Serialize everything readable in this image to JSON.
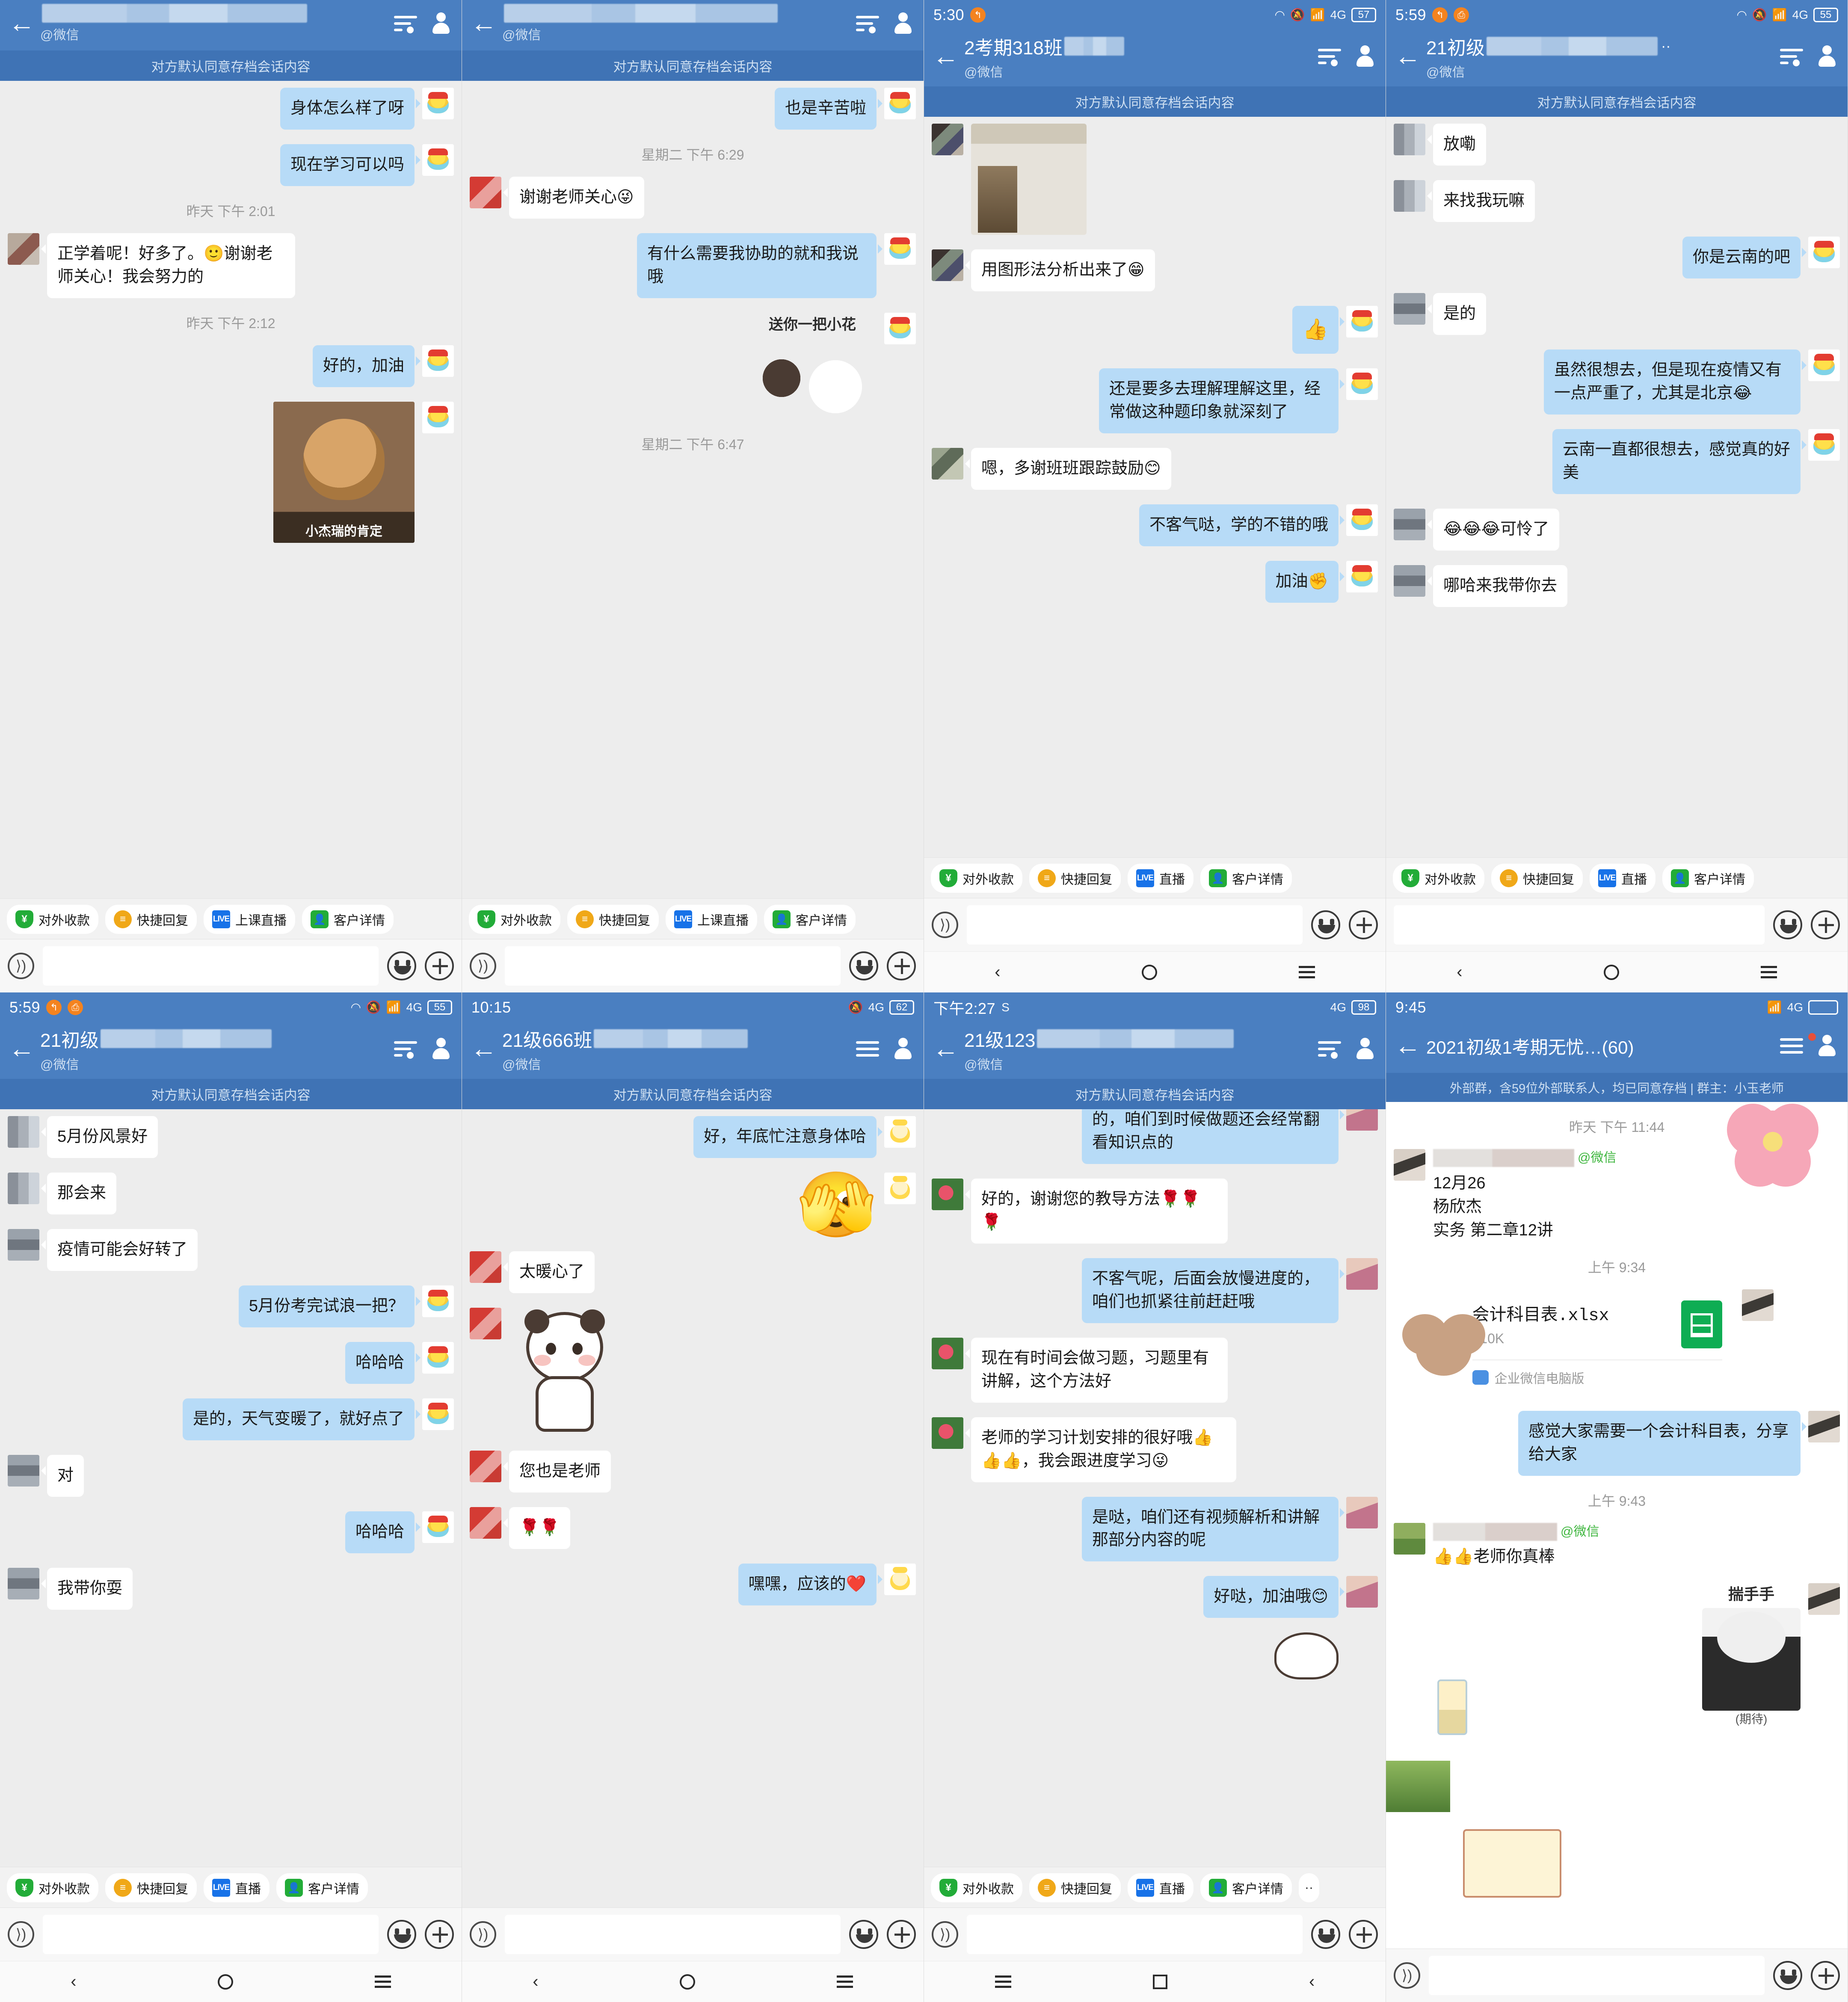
{
  "common": {
    "archive_notice": "对方默认同意存档会话内容",
    "subtitle": "@微信",
    "quick_actions": [
      {
        "label": "对外收款",
        "icon": "pay-icon"
      },
      {
        "label": "快捷回复",
        "icon": "quick-reply-icon"
      },
      {
        "label": "上课直播",
        "icon": "live-icon"
      },
      {
        "label": "客户详情",
        "icon": "customer-icon"
      }
    ],
    "quick_actions_short": [
      {
        "label": "对外收款",
        "icon": "pay-icon"
      },
      {
        "label": "快捷回复",
        "icon": "quick-reply-icon"
      },
      {
        "label": "直播",
        "icon": "live-icon"
      },
      {
        "label": "客户详情",
        "icon": "customer-icon"
      }
    ],
    "live_badge": "LIVE",
    "colors": {
      "header_blue": "#4a7fc1",
      "archive_blue": "#3f73b5",
      "bubble_out": "#b7dbf7",
      "bubble_in": "#ffffff",
      "chat_bg": "#ededed",
      "accent_green": "#22ac38",
      "accent_orange": "#f0a818",
      "accent_live": "#1772e8",
      "badge_red": "#e8503a",
      "status_orange": "#f4831f"
    }
  },
  "panels": [
    {
      "id": "panel-1",
      "status": {
        "time": "",
        "battery": "",
        "net": ""
      },
      "title": "",
      "messages": [
        {
          "side": "out",
          "type": "text",
          "text": "身体怎么样了呀",
          "avatar": "bee"
        },
        {
          "side": "out",
          "type": "text",
          "text": "现在学习可以吗",
          "avatar": "bee"
        },
        {
          "type": "timestamp",
          "text": "昨天 下午 2:01"
        },
        {
          "side": "in",
          "type": "text",
          "text": "正学着呢！好多了。🙂谢谢老师关心！我会努力的",
          "avatar": "mosaic-brown"
        },
        {
          "type": "timestamp",
          "text": "昨天 下午 2:12"
        },
        {
          "side": "out",
          "type": "text",
          "text": "好的，加油",
          "avatar": "bee"
        },
        {
          "side": "out",
          "type": "meme",
          "text": "小杰瑞的肯定",
          "avatar": "bee"
        }
      ]
    },
    {
      "id": "panel-2",
      "status": {
        "time": "",
        "battery": "",
        "net": ""
      },
      "title": "",
      "messages": [
        {
          "side": "out",
          "type": "text",
          "text": "也是辛苦啦",
          "avatar": "bee"
        },
        {
          "type": "timestamp",
          "text": "星期二 下午 6:29"
        },
        {
          "side": "in",
          "type": "text",
          "text": "谢谢老师关心😜",
          "avatar": "mosaic-red"
        },
        {
          "side": "out",
          "type": "text",
          "text": "有什么需要我协助的就和我说哦",
          "avatar": "bee"
        },
        {
          "side": "out",
          "type": "sticker",
          "text": "送你一把小花",
          "avatar": "bee"
        },
        {
          "type": "timestamp",
          "text": "星期二 下午 6:47"
        }
      ]
    },
    {
      "id": "panel-3",
      "status": {
        "time": "5:30",
        "battery": "57",
        "net": "4G"
      },
      "title": "2考期318班",
      "messages": [
        {
          "side": "in",
          "type": "image",
          "avatar": "mosaic-dark"
        },
        {
          "side": "in",
          "type": "text",
          "text": "用图形法分析出来了😁",
          "avatar": "mosaic-dark"
        },
        {
          "side": "out",
          "type": "emoji",
          "text": "👍",
          "avatar": "bee"
        },
        {
          "side": "out",
          "type": "text",
          "text": "还是要多去理解理解这里，经常做这种题印象就深刻了",
          "avatar": "bee"
        },
        {
          "side": "in",
          "type": "text",
          "text": "嗯，多谢班班跟踪鼓励😊",
          "avatar": "mosaic-olive"
        },
        {
          "side": "out",
          "type": "text",
          "text": "不客气哒，学的不错的哦",
          "avatar": "bee"
        },
        {
          "side": "out",
          "type": "text",
          "text": "加油✊",
          "avatar": "bee"
        }
      ]
    },
    {
      "id": "panel-4",
      "status": {
        "time": "5:59",
        "battery": "55",
        "net": "4G"
      },
      "title": "21初级",
      "messages": [
        {
          "side": "in",
          "type": "text",
          "text": "放嘞",
          "avatar": "mosaic-gray"
        },
        {
          "side": "in",
          "type": "text",
          "text": "来找我玩嘛",
          "avatar": "mosaic-gray"
        },
        {
          "side": "out",
          "type": "text",
          "text": "你是云南的吧",
          "avatar": "bee"
        },
        {
          "side": "in",
          "type": "text",
          "text": "是的",
          "avatar": "mosaic-gray2"
        },
        {
          "side": "out",
          "type": "text",
          "text": "虽然很想去，但是现在疫情又有一点严重了，尤其是北京😂",
          "avatar": "bee"
        },
        {
          "side": "out",
          "type": "text",
          "text": "云南一直都很想去，感觉真的好美",
          "avatar": "bee"
        },
        {
          "side": "in",
          "type": "text",
          "text": "😂😂😂可怜了",
          "avatar": "mosaic-gray2"
        },
        {
          "side": "in",
          "type": "text",
          "text": "哪哈来我带你去",
          "avatar": "mosaic-gray2"
        }
      ]
    },
    {
      "id": "panel-5",
      "status": {
        "time": "5:59",
        "battery": "55",
        "net": "4G"
      },
      "title": "21初级",
      "messages": [
        {
          "side": "in",
          "type": "text",
          "text": "5月份风景好",
          "avatar": "mosaic-gray"
        },
        {
          "side": "in",
          "type": "text",
          "text": "那会来",
          "avatar": "mosaic-gray"
        },
        {
          "side": "in",
          "type": "text",
          "text": "疫情可能会好转了",
          "avatar": "mosaic-gray2"
        },
        {
          "side": "out",
          "type": "text",
          "text": "5月份考完试浪一把？",
          "avatar": "bee"
        },
        {
          "side": "out",
          "type": "text",
          "text": "哈哈哈",
          "avatar": "bee"
        },
        {
          "side": "out",
          "type": "text",
          "text": "是的，天气变暖了，就好点了",
          "avatar": "bee"
        },
        {
          "side": "in",
          "type": "text",
          "text": "对",
          "avatar": "mosaic-gray2"
        },
        {
          "side": "out",
          "type": "text",
          "text": "哈哈哈",
          "avatar": "bee"
        },
        {
          "side": "in",
          "type": "text",
          "text": "我带你耍",
          "avatar": "mosaic-gray2"
        }
      ]
    },
    {
      "id": "panel-6",
      "status": {
        "time": "10:15",
        "battery": "62",
        "net": "4G"
      },
      "title": "21级666班",
      "messages": [
        {
          "side": "out",
          "type": "text",
          "text": "好，年底忙注意身体哈",
          "avatar": "bee2"
        },
        {
          "side": "out",
          "type": "emoji",
          "text": "🫣",
          "avatar": "bee2"
        },
        {
          "side": "in",
          "type": "text",
          "text": "太暖心了",
          "avatar": "mosaic-red"
        },
        {
          "side": "in",
          "type": "panda",
          "avatar": "mosaic-red"
        },
        {
          "side": "in",
          "type": "text",
          "text": "您也是老师",
          "avatar": "mosaic-red"
        },
        {
          "side": "in",
          "type": "text",
          "text": "🌹🌹",
          "avatar": "mosaic-red"
        },
        {
          "side": "out",
          "type": "text",
          "text": "嘿嘿，应该的❤️",
          "avatar": "bee2"
        }
      ]
    },
    {
      "id": "panel-7",
      "status": {
        "time": "下午2:27",
        "battery": "98",
        "net": "4G"
      },
      "title": "21级123",
      "messages": [
        {
          "side": "out",
          "type": "text",
          "text": "的，咱们到时候做题还会经常翻看知识点的",
          "avatar": "photo-woman"
        },
        {
          "side": "in",
          "type": "text",
          "text": "好的，谢谢您的教导方法🌹🌹🌹",
          "avatar": "photo-rose"
        },
        {
          "side": "out",
          "type": "text",
          "text": "不客气呢，后面会放慢进度的，咱们也抓紧往前赶赶哦",
          "avatar": "photo-woman"
        },
        {
          "side": "in",
          "type": "text",
          "text": "现在有时间会做习题，习题里有讲解，这个方法好",
          "avatar": "photo-rose"
        },
        {
          "side": "in",
          "type": "text",
          "text": "老师的学习计划安排的很好哦👍👍👍，我会跟进度学习😜",
          "avatar": "photo-rose"
        },
        {
          "side": "out",
          "type": "text",
          "text": "是哒，咱们还有视频解析和讲解那部分内容的呢",
          "avatar": "photo-woman"
        },
        {
          "side": "out",
          "type": "text",
          "text": "好哒，加油哦😊",
          "avatar": "photo-woman"
        },
        {
          "side": "in",
          "type": "sticker-plain",
          "avatar": "photo-woman"
        }
      ]
    },
    {
      "id": "panel-8",
      "status": {
        "time": "9:45",
        "battery": "",
        "net": "4G"
      },
      "title": "2021初级1考期无忧…(60)",
      "group_notice": "外部群，含59位外部联系人，均已同意存档 | 群主：小玉老师",
      "messages": [
        {
          "type": "timestamp",
          "text": "昨天 下午 11:44"
        },
        {
          "side": "in",
          "type": "namecard",
          "avatar": "photo-girl",
          "wechat_tag": "@微信",
          "lines": [
            "12月26",
            "杨欣杰",
            "实务  第二章12讲"
          ]
        },
        {
          "type": "timestamp",
          "text": "上午 9:34"
        },
        {
          "side": "in",
          "type": "file",
          "filename": "会计科目表.xlsx",
          "filesize": "310K",
          "source": "企业微信电脑版",
          "avatar": "spacer"
        },
        {
          "side": "out",
          "type": "text",
          "text": "感觉大家需要一个会计科目表，分享给大家",
          "avatar": "photo-girl"
        },
        {
          "type": "timestamp",
          "text": "上午 9:43"
        },
        {
          "side": "in",
          "type": "namecard2",
          "avatar": "photo-field",
          "wechat_tag": "@微信",
          "lines": [
            "👍👍老师你真棒"
          ]
        },
        {
          "side": "in",
          "type": "sticker-panda",
          "text": "揣手手",
          "subtext": "(期待)",
          "avatar": "spacer"
        }
      ]
    }
  ]
}
